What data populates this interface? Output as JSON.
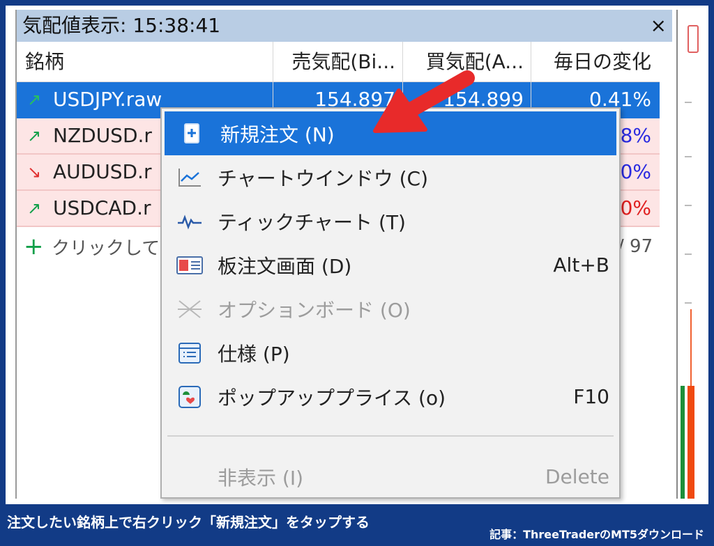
{
  "market_watch": {
    "title": "気配値表示: 15:38:41",
    "close_glyph": "×",
    "columns": [
      "銘柄",
      "売気配(Bi...",
      "買気配(A...",
      "毎日の変化"
    ],
    "rows": [
      {
        "symbol": "USDJPY.raw",
        "bid": "154.897",
        "ask": "154.899",
        "change": "0.41%",
        "trend": "up"
      },
      {
        "symbol": "NZDUSD.r",
        "bid": "",
        "ask": "",
        "change": "28%",
        "trend": "up"
      },
      {
        "symbol": "AUDUSD.r",
        "bid": "",
        "ask": "",
        "change": "20%",
        "trend": "down"
      },
      {
        "symbol": "USDCAD.r",
        "bid": "",
        "ask": "",
        "change": "10%",
        "trend": "up"
      }
    ],
    "add_row": {
      "label": "クリックして",
      "count": "/ 97"
    }
  },
  "context_menu": {
    "items": [
      {
        "label": "新規注文 (N)",
        "shortcut": "",
        "icon": "new-order-icon",
        "state": "active"
      },
      {
        "label": "チャートウインドウ (C)",
        "shortcut": "",
        "icon": "chart-window-icon",
        "state": "normal"
      },
      {
        "label": "ティックチャート (T)",
        "shortcut": "",
        "icon": "tick-chart-icon",
        "state": "normal"
      },
      {
        "label": "板注文画面 (D)",
        "shortcut": "Alt+B",
        "icon": "depth-of-market-icon",
        "state": "normal"
      },
      {
        "label": "オプションボード (O)",
        "shortcut": "",
        "icon": "option-board-icon",
        "state": "disabled"
      },
      {
        "label": "仕様 (P)",
        "shortcut": "",
        "icon": "specification-icon",
        "state": "normal"
      },
      {
        "label": "ポップアッププライス (o)",
        "shortcut": "F10",
        "icon": "popup-prices-icon",
        "state": "normal"
      },
      {
        "label": "非表示 (I)",
        "shortcut": "Delete",
        "icon": "",
        "state": "disabled"
      }
    ]
  },
  "caption": "注文したい銘柄上で右クリック「新規注文」をタップする",
  "credit": "記事：ThreeTraderのMT5ダウンロード",
  "colors": {
    "selection": "#1a73d9",
    "title_bar": "#b9cde4",
    "up": "#12a04a",
    "down": "#e03030",
    "annotation_arrow": "#e82a2a",
    "footer": "#123b86"
  }
}
